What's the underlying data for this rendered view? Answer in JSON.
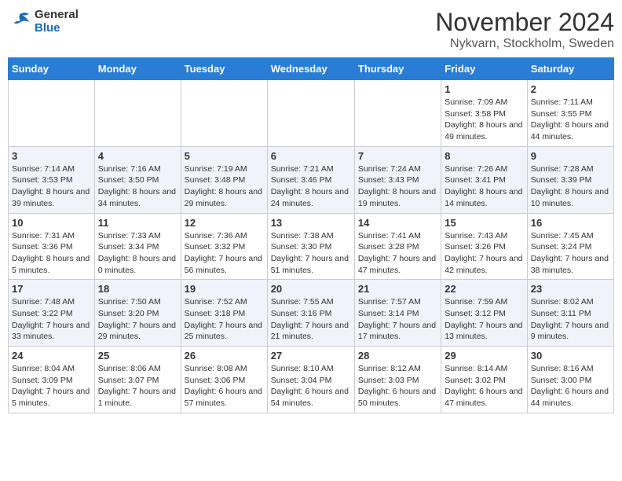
{
  "logo": {
    "text_general": "General",
    "text_blue": "Blue"
  },
  "header": {
    "month": "November 2024",
    "location": "Nykvarn, Stockholm, Sweden"
  },
  "weekdays": [
    "Sunday",
    "Monday",
    "Tuesday",
    "Wednesday",
    "Thursday",
    "Friday",
    "Saturday"
  ],
  "weeks": [
    [
      {
        "day": "",
        "info": ""
      },
      {
        "day": "",
        "info": ""
      },
      {
        "day": "",
        "info": ""
      },
      {
        "day": "",
        "info": ""
      },
      {
        "day": "",
        "info": ""
      },
      {
        "day": "1",
        "info": "Sunrise: 7:09 AM\nSunset: 3:58 PM\nDaylight: 8 hours and 49 minutes."
      },
      {
        "day": "2",
        "info": "Sunrise: 7:11 AM\nSunset: 3:55 PM\nDaylight: 8 hours and 44 minutes."
      }
    ],
    [
      {
        "day": "3",
        "info": "Sunrise: 7:14 AM\nSunset: 3:53 PM\nDaylight: 8 hours and 39 minutes."
      },
      {
        "day": "4",
        "info": "Sunrise: 7:16 AM\nSunset: 3:50 PM\nDaylight: 8 hours and 34 minutes."
      },
      {
        "day": "5",
        "info": "Sunrise: 7:19 AM\nSunset: 3:48 PM\nDaylight: 8 hours and 29 minutes."
      },
      {
        "day": "6",
        "info": "Sunrise: 7:21 AM\nSunset: 3:46 PM\nDaylight: 8 hours and 24 minutes."
      },
      {
        "day": "7",
        "info": "Sunrise: 7:24 AM\nSunset: 3:43 PM\nDaylight: 8 hours and 19 minutes."
      },
      {
        "day": "8",
        "info": "Sunrise: 7:26 AM\nSunset: 3:41 PM\nDaylight: 8 hours and 14 minutes."
      },
      {
        "day": "9",
        "info": "Sunrise: 7:28 AM\nSunset: 3:39 PM\nDaylight: 8 hours and 10 minutes."
      }
    ],
    [
      {
        "day": "10",
        "info": "Sunrise: 7:31 AM\nSunset: 3:36 PM\nDaylight: 8 hours and 5 minutes."
      },
      {
        "day": "11",
        "info": "Sunrise: 7:33 AM\nSunset: 3:34 PM\nDaylight: 8 hours and 0 minutes."
      },
      {
        "day": "12",
        "info": "Sunrise: 7:36 AM\nSunset: 3:32 PM\nDaylight: 7 hours and 56 minutes."
      },
      {
        "day": "13",
        "info": "Sunrise: 7:38 AM\nSunset: 3:30 PM\nDaylight: 7 hours and 51 minutes."
      },
      {
        "day": "14",
        "info": "Sunrise: 7:41 AM\nSunset: 3:28 PM\nDaylight: 7 hours and 47 minutes."
      },
      {
        "day": "15",
        "info": "Sunrise: 7:43 AM\nSunset: 3:26 PM\nDaylight: 7 hours and 42 minutes."
      },
      {
        "day": "16",
        "info": "Sunrise: 7:45 AM\nSunset: 3:24 PM\nDaylight: 7 hours and 38 minutes."
      }
    ],
    [
      {
        "day": "17",
        "info": "Sunrise: 7:48 AM\nSunset: 3:22 PM\nDaylight: 7 hours and 33 minutes."
      },
      {
        "day": "18",
        "info": "Sunrise: 7:50 AM\nSunset: 3:20 PM\nDaylight: 7 hours and 29 minutes."
      },
      {
        "day": "19",
        "info": "Sunrise: 7:52 AM\nSunset: 3:18 PM\nDaylight: 7 hours and 25 minutes."
      },
      {
        "day": "20",
        "info": "Sunrise: 7:55 AM\nSunset: 3:16 PM\nDaylight: 7 hours and 21 minutes."
      },
      {
        "day": "21",
        "info": "Sunrise: 7:57 AM\nSunset: 3:14 PM\nDaylight: 7 hours and 17 minutes."
      },
      {
        "day": "22",
        "info": "Sunrise: 7:59 AM\nSunset: 3:12 PM\nDaylight: 7 hours and 13 minutes."
      },
      {
        "day": "23",
        "info": "Sunrise: 8:02 AM\nSunset: 3:11 PM\nDaylight: 7 hours and 9 minutes."
      }
    ],
    [
      {
        "day": "24",
        "info": "Sunrise: 8:04 AM\nSunset: 3:09 PM\nDaylight: 7 hours and 5 minutes."
      },
      {
        "day": "25",
        "info": "Sunrise: 8:06 AM\nSunset: 3:07 PM\nDaylight: 7 hours and 1 minute."
      },
      {
        "day": "26",
        "info": "Sunrise: 8:08 AM\nSunset: 3:06 PM\nDaylight: 6 hours and 57 minutes."
      },
      {
        "day": "27",
        "info": "Sunrise: 8:10 AM\nSunset: 3:04 PM\nDaylight: 6 hours and 54 minutes."
      },
      {
        "day": "28",
        "info": "Sunrise: 8:12 AM\nSunset: 3:03 PM\nDaylight: 6 hours and 50 minutes."
      },
      {
        "day": "29",
        "info": "Sunrise: 8:14 AM\nSunset: 3:02 PM\nDaylight: 6 hours and 47 minutes."
      },
      {
        "day": "30",
        "info": "Sunrise: 8:16 AM\nSunset: 3:00 PM\nDaylight: 6 hours and 44 minutes."
      }
    ]
  ]
}
